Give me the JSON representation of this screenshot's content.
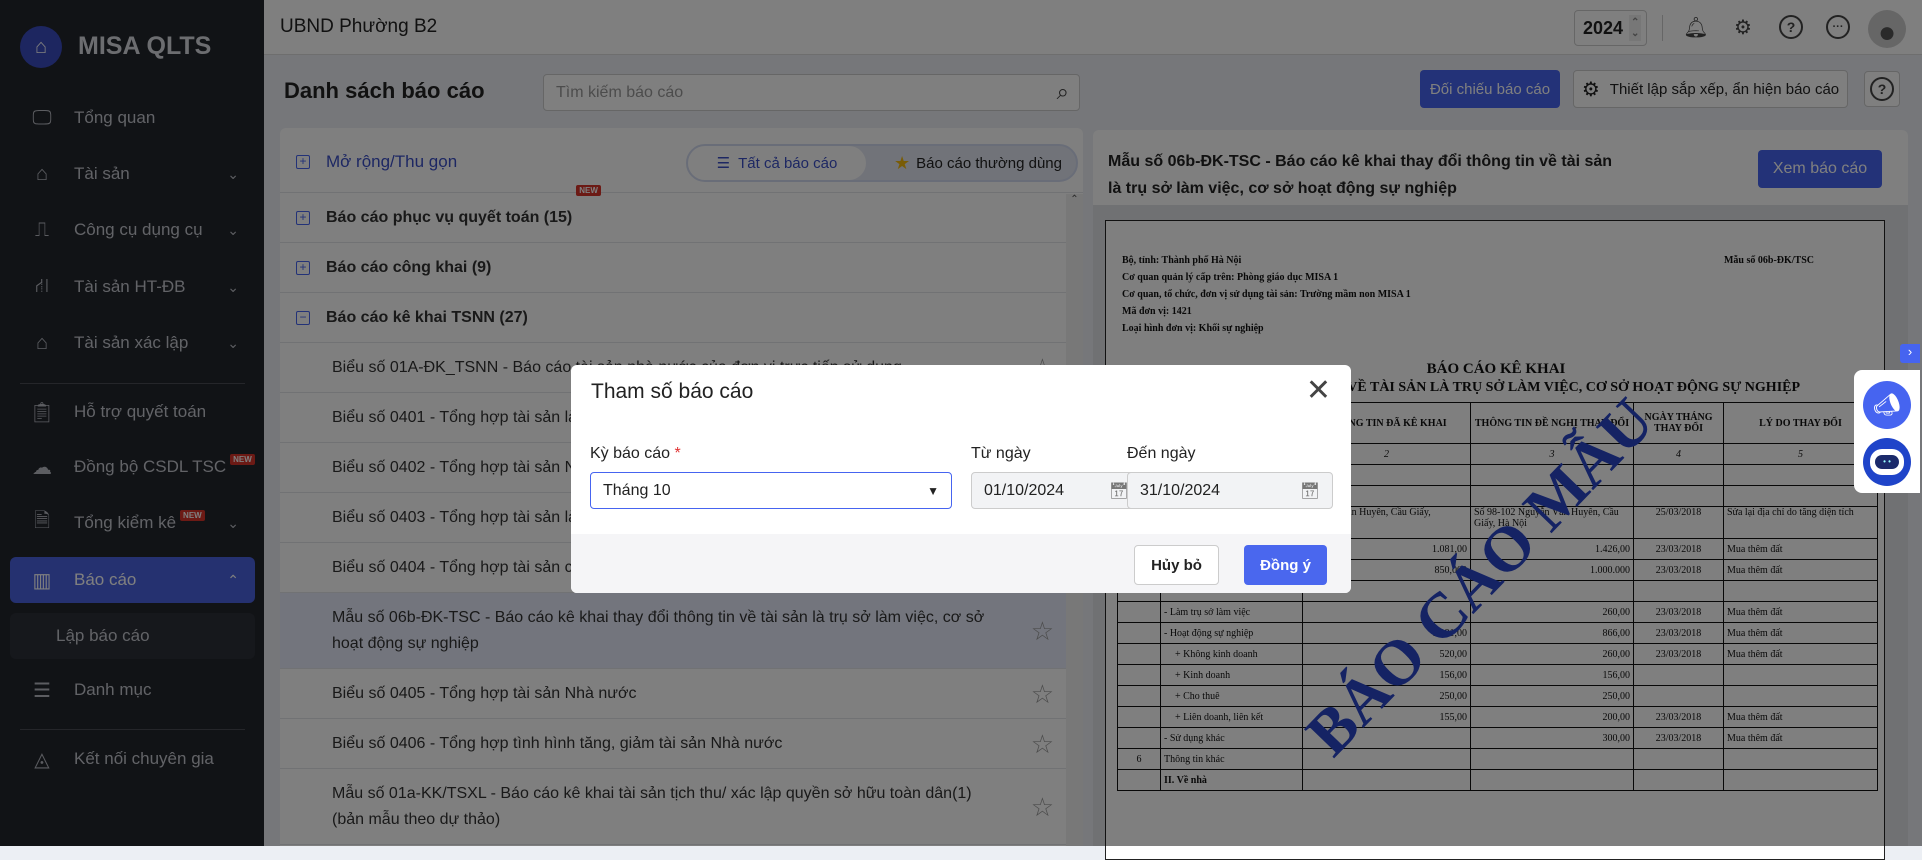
{
  "app": {
    "name": "MISA QLTS",
    "org": "UBND Phường B2",
    "year": "2024"
  },
  "sidebar": {
    "items": [
      {
        "label": "Tổng quan",
        "icon": "monitor-chart-icon"
      },
      {
        "label": "Tài sản",
        "icon": "car-house-icon"
      },
      {
        "label": "Công cụ dụng cụ",
        "icon": "paint-roller-icon"
      },
      {
        "label": "Tài sản HT-ĐB",
        "icon": "road-icon"
      },
      {
        "label": "Tài sản xác lập",
        "icon": "car-house-icon"
      },
      {
        "label": "Hỗ trợ quyết toán",
        "icon": "clipboard-icon"
      },
      {
        "label": "Đồng bộ CSDL TSC",
        "icon": "cloud-upload-icon",
        "badge": "NEW"
      },
      {
        "label": "Tổng kiểm kê",
        "icon": "document-check-icon",
        "badge": "NEW"
      },
      {
        "label": "Báo cáo",
        "icon": "bar-chart-icon"
      },
      {
        "label": "Lập báo cáo"
      },
      {
        "label": "Danh mục",
        "icon": "list-icon"
      },
      {
        "label": "Kết nối chuyên gia",
        "icon": "expert-icon"
      }
    ]
  },
  "page": {
    "title": "Danh sách báo cáo",
    "search_placeholder": "Tìm kiếm báo cáo",
    "compare_btn": "Đối chiếu báo cáo",
    "settings_btn": "Thiết lập sắp xếp, ẩn hiện báo cáo",
    "help": "?"
  },
  "list": {
    "expand": "Mở rộng/Thu gọn",
    "tab_all": "Tất cả báo cáo",
    "tab_fav": "Báo cáo thường dùng",
    "groups": [
      {
        "label": "Báo cáo phục vụ quyết toán (15)",
        "badge": "NEW",
        "sign": "+"
      },
      {
        "label": "Báo cáo công khai (9)",
        "sign": "+"
      },
      {
        "label": "Báo cáo kê khai TSNN (27)",
        "sign": "−"
      }
    ],
    "items": [
      "Biểu số 01A-ĐK_TSNN - Báo cáo tài sản nhà nước của đơn vị trực tiếp sử dụng",
      "Biểu số 0401 - Tổng hợp tài sản là trụ sở làm việc",
      "Biểu số 0402 - Tổng hợp tài sản Nhà nước",
      "Biểu số 0403 - Tổng hợp tài sản là",
      "Biểu số 0404 - Tổng hợp tài sản cố định",
      "Mẫu số 06b-ĐK-TSC - Báo cáo kê khai thay đổi thông tin về tài sản là trụ sở làm việc, cơ sở hoạt động sự nghiệp",
      "Biểu số 0405 - Tổng hợp tài sản Nhà nước",
      "Biểu số 0406 - Tổng hợp tình hình tăng, giảm tài sản Nhà nước",
      "Mẫu số 01a-KK/TSXL - Báo cáo kê khai tài sản tịch thu/ xác lập quyền sở hữu toàn dân(1) (bản mẫu theo dự thảo)"
    ]
  },
  "preview": {
    "title": "Mẫu số 06b-ĐK-TSC - Báo cáo kê khai thay đổi thông tin về tài sản là trụ sở làm việc, cơ sở hoạt động sự nghiệp",
    "view_btn": "Xem báo cáo",
    "info": [
      "Bộ, tỉnh: Thành phố Hà Nội",
      "Cơ quan quản lý cấp trên: Phòng giáo dục MISA 1",
      "Cơ quan, tổ chức, đơn vị sử dụng tài sản: Trường mầm non MISA 1",
      "Mã đơn vị: 1421",
      "Loại hình đơn vị: Khối sự nghiệp"
    ],
    "form_code": "Mẫu số 06b-ĐK/TSC",
    "report_title": "BÁO CÁO KÊ KHAI",
    "report_subtitle": "THAY ĐỔI THÔNG TIN VỀ TÀI SẢN LÀ TRỤ SỞ LÀM VIỆC, CƠ SỞ HOẠT ĐỘNG SỰ NGHIỆP",
    "headers": [
      "",
      "",
      "THÔNG TIN ĐÃ KÊ KHAI",
      "THÔNG TIN ĐỀ NGHỊ THAY ĐỔI",
      "NGÀY THÁNG THAY ĐỔI",
      "LÝ DO THAY ĐỔI"
    ],
    "col_numbers": [
      "",
      "",
      "2",
      "3",
      "4",
      "5"
    ],
    "rows": [
      [
        "",
        "",
        "",
        "",
        "",
        ""
      ],
      [
        "",
        "",
        "",
        "",
        "",
        ""
      ],
      [
        "",
        "",
        "Nguyễn Văn Huyên, Cầu Giấy,",
        "Số 98-102 Nguyễn Văn Huyên, Cầu Giấy, Hà Nội",
        "25/03/2018",
        "Sửa lại địa chỉ do tăng diện tích"
      ],
      [
        "",
        "",
        "1.081,00",
        "1.426,00",
        "23/03/2018",
        "Mua thêm đất"
      ],
      [
        "",
        "",
        "850,000",
        "1.000.000",
        "23/03/2018",
        "Mua thêm đất"
      ],
      [
        "",
        "",
        "",
        "",
        "",
        ""
      ],
      [
        "",
        "- Làm trụ sở làm việc",
        "",
        "260,00",
        "23/03/2018",
        "Mua thêm đất"
      ],
      [
        "",
        "- Hoạt động sự nghiệp",
        "1.081,00",
        "866,00",
        "23/03/2018",
        "Mua thêm đất"
      ],
      [
        "",
        "+ Không kinh doanh",
        "520,00",
        "260,00",
        "23/03/2018",
        "Mua thêm đất"
      ],
      [
        "",
        "+ Kinh doanh",
        "156,00",
        "156,00",
        "",
        ""
      ],
      [
        "",
        "+ Cho thuê",
        "250,00",
        "250,00",
        "",
        ""
      ],
      [
        "",
        "+ Liên doanh, liên kết",
        "155,00",
        "200,00",
        "23/03/2018",
        "Mua thêm đất"
      ],
      [
        "",
        "- Sử dụng khác",
        "",
        "300,00",
        "23/03/2018",
        "Mua thêm đất"
      ],
      [
        "6",
        "Thông tin khác",
        "",
        "",
        "",
        ""
      ],
      [
        "",
        "II. Về nhà",
        "",
        "",
        "",
        ""
      ]
    ],
    "watermark": "BÁO CÁO MẪU"
  },
  "dialog": {
    "title": "Tham số báo cáo",
    "period_label": "Kỳ báo cáo",
    "required": "*",
    "period_value": "Tháng 10",
    "from_label": "Từ ngày",
    "from_value": "01/10/2024",
    "to_label": "Đến ngày",
    "to_value": "31/10/2024",
    "cancel": "Hủy bỏ",
    "ok": "Đồng ý"
  }
}
